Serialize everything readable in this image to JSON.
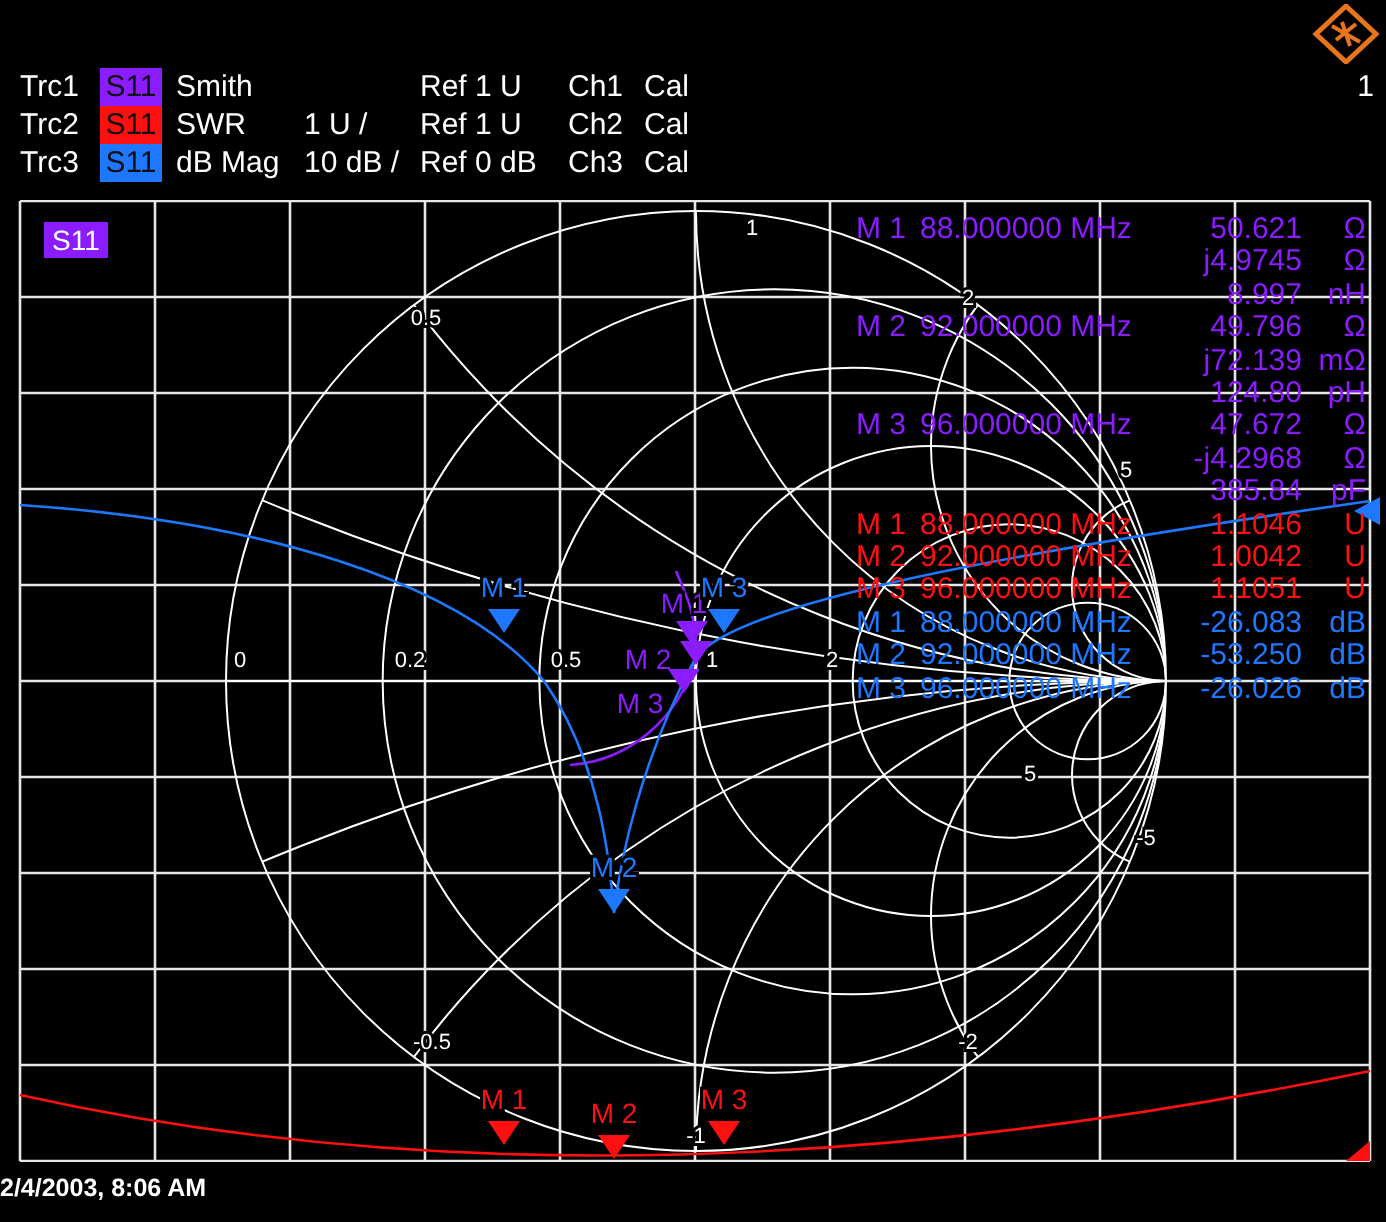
{
  "traces": [
    {
      "name": "Trc1",
      "param": "S11",
      "color": "#8a1cff",
      "format": "Smith",
      "ref": "Ref 1 U",
      "channel": "Ch1",
      "cal": "Cal",
      "markers": [
        {
          "label": "M 1"
        },
        {
          "label": "M 2"
        },
        {
          "label": "M 3"
        }
      ],
      "readouts": [
        {
          "label": "M 1",
          "frequency": "88.000000 MHz",
          "values": [
            {
              "value": "50.621",
              "unit": "Ω"
            },
            {
              "value": "j4.9745",
              "unit": "Ω"
            },
            {
              "value": "8.997",
              "unit": "nH"
            }
          ]
        },
        {
          "label": "M 2",
          "frequency": "92.000000 MHz",
          "values": [
            {
              "value": "49.796",
              "unit": "Ω"
            },
            {
              "value": "j72.139",
              "unit": "mΩ"
            },
            {
              "value": "124.80",
              "unit": "pH"
            }
          ]
        },
        {
          "label": "M 3",
          "frequency": "96.000000 MHz",
          "values": [
            {
              "value": "47.672",
              "unit": "Ω"
            },
            {
              "value": "-j4.2968",
              "unit": "Ω"
            },
            {
              "value": "385.84",
              "unit": "pF"
            }
          ]
        }
      ]
    },
    {
      "name": "Trc2",
      "param": "S11",
      "color": "#ff1010",
      "format": "SWR",
      "scale": "1 U /",
      "ref": "Ref 1 U",
      "channel": "Ch2",
      "cal": "Cal",
      "markers": [
        {
          "label": "M 1"
        },
        {
          "label": "M 2"
        },
        {
          "label": "M 3"
        }
      ],
      "readouts": [
        {
          "label": "M 1",
          "frequency": "88.000000 MHz",
          "values": [
            {
              "value": "1.1046",
              "unit": "U"
            }
          ]
        },
        {
          "label": "M 2",
          "frequency": "92.000000 MHz",
          "values": [
            {
              "value": "1.0042",
              "unit": "U"
            }
          ]
        },
        {
          "label": "M 3",
          "frequency": "96.000000 MHz",
          "values": [
            {
              "value": "1.1051",
              "unit": "U"
            }
          ]
        }
      ]
    },
    {
      "name": "Trc3",
      "param": "S11",
      "color": "#1e78ff",
      "format": "dB Mag",
      "scale": "10 dB /",
      "ref": "Ref 0 dB",
      "channel": "Ch3",
      "cal": "Cal",
      "markers": [
        {
          "label": "M 1"
        },
        {
          "label": "M 2"
        },
        {
          "label": "M 3"
        }
      ],
      "readouts": [
        {
          "label": "M 1",
          "frequency": "88.000000 MHz",
          "values": [
            {
              "value": "-26.083",
              "unit": "dB"
            }
          ]
        },
        {
          "label": "M 2",
          "frequency": "92.000000 MHz",
          "values": [
            {
              "value": "-53.250",
              "unit": "dB"
            }
          ]
        },
        {
          "label": "M 3",
          "frequency": "96.000000 MHz",
          "values": [
            {
              "value": "-26.026",
              "unit": "dB"
            }
          ]
        }
      ]
    }
  ],
  "diagram": {
    "badge": "S11",
    "channel_number": "1",
    "smith_labels": [
      "0.5",
      "1",
      "2",
      "5",
      "0",
      "0.2",
      "0.5",
      "1",
      "2",
      "5",
      "-5",
      "-2",
      "-1",
      "-0.5"
    ]
  },
  "timestamp": "2/4/2003, 8:06 AM"
}
